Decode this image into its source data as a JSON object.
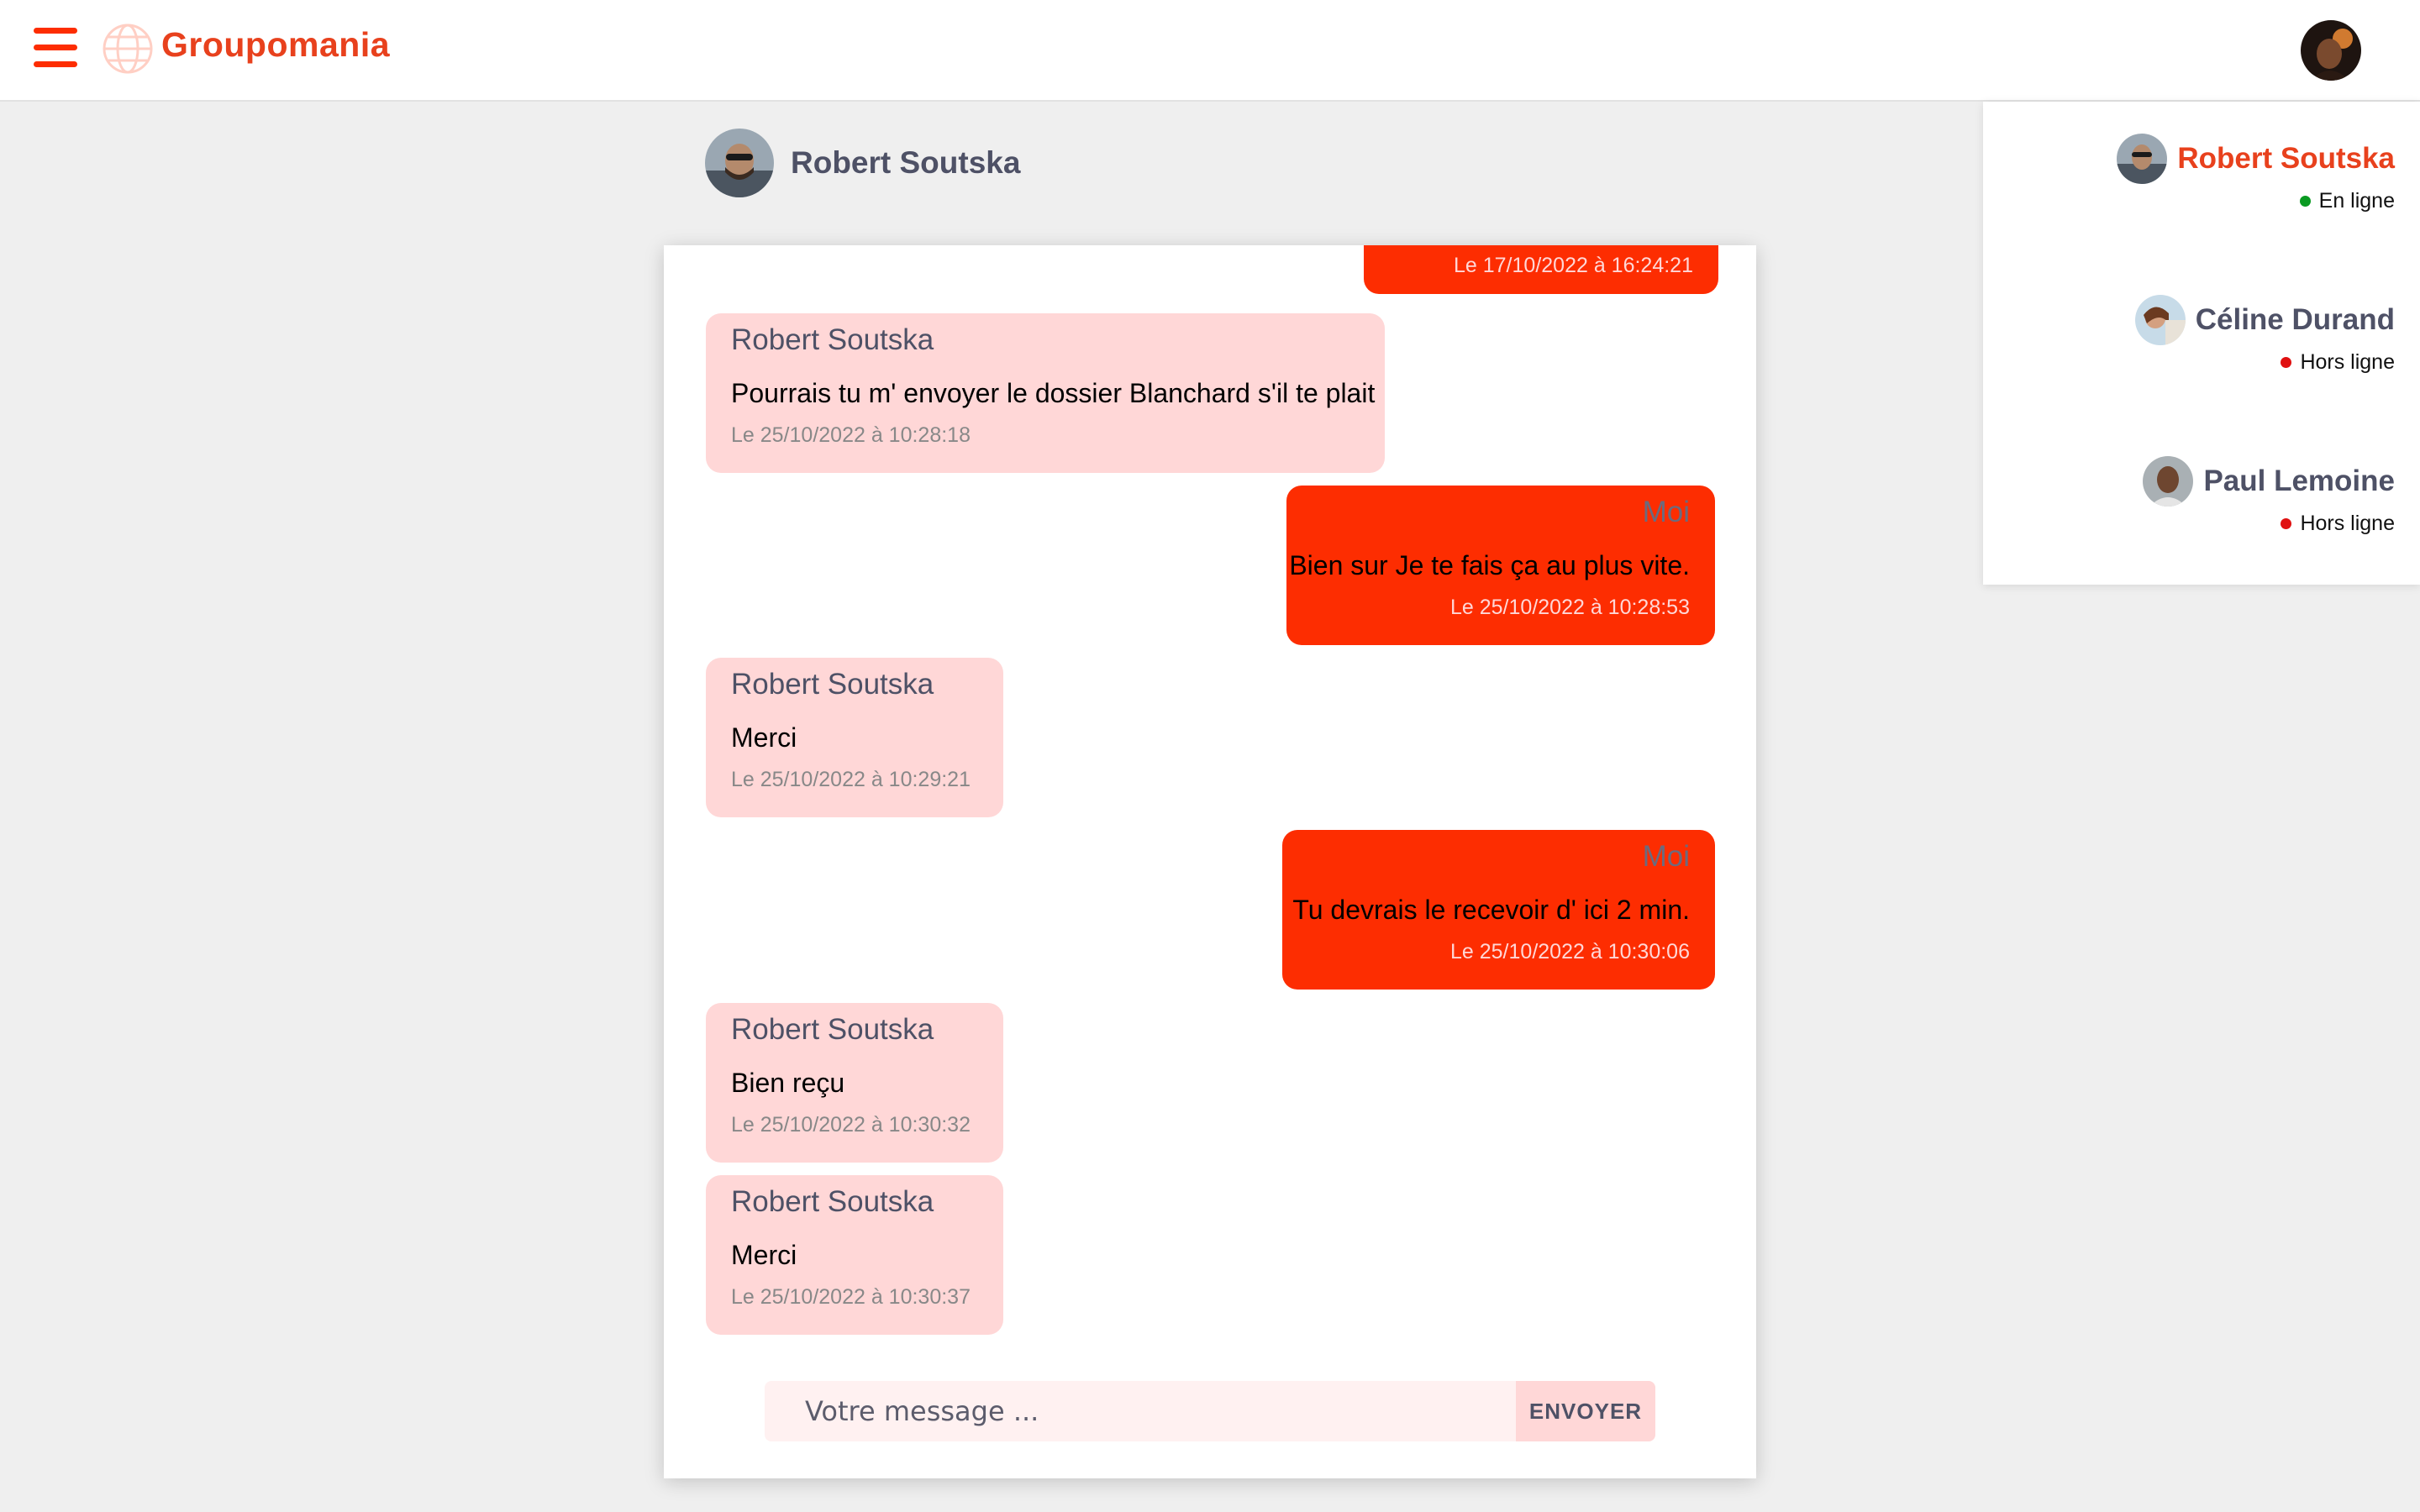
{
  "app": {
    "brand": "Groupomania"
  },
  "colors": {
    "primary": "#fd2d01",
    "secondary": "#ffd7d7",
    "tertiary": "#4e5166",
    "online": "#0a9a22",
    "offline": "#e01010"
  },
  "icons": {
    "menu": "hamburger-menu-icon",
    "logo": "globe-icon"
  },
  "conversation": {
    "name": "Robert Soutska",
    "messages": [
      {
        "side": "out",
        "author": "",
        "text": "",
        "date": "Le 17/10/2022 à 16:24:21"
      },
      {
        "side": "in",
        "author": "Robert Soutska",
        "text": "Pourrais tu m' envoyer le dossier Blanchard s'il te plait",
        "date": "Le 25/10/2022 à 10:28:18"
      },
      {
        "side": "out",
        "author": "Moi",
        "text": "Bien sur Je te fais ça au plus vite.",
        "date": "Le 25/10/2022 à 10:28:53"
      },
      {
        "side": "in",
        "author": "Robert Soutska",
        "text": "Merci",
        "date": "Le 25/10/2022 à 10:29:21"
      },
      {
        "side": "out",
        "author": "Moi",
        "text": "Tu devrais le recevoir d' ici 2 min.",
        "date": "Le 25/10/2022 à 10:30:06"
      },
      {
        "side": "in",
        "author": "Robert Soutska",
        "text": "Bien reçu",
        "date": "Le 25/10/2022 à 10:30:32"
      },
      {
        "side": "in",
        "author": "Robert Soutska",
        "text": "Merci",
        "date": "Le 25/10/2022 à 10:30:37"
      }
    ]
  },
  "composer": {
    "placeholder": "Votre message ...",
    "send_label": "ENVOYER"
  },
  "contacts": [
    {
      "name": "Robert Soutska",
      "status": "En ligne",
      "online": true
    },
    {
      "name": "Céline Durand",
      "status": "Hors ligne",
      "online": false
    },
    {
      "name": "Paul Lemoine",
      "status": "Hors ligne",
      "online": false
    }
  ]
}
